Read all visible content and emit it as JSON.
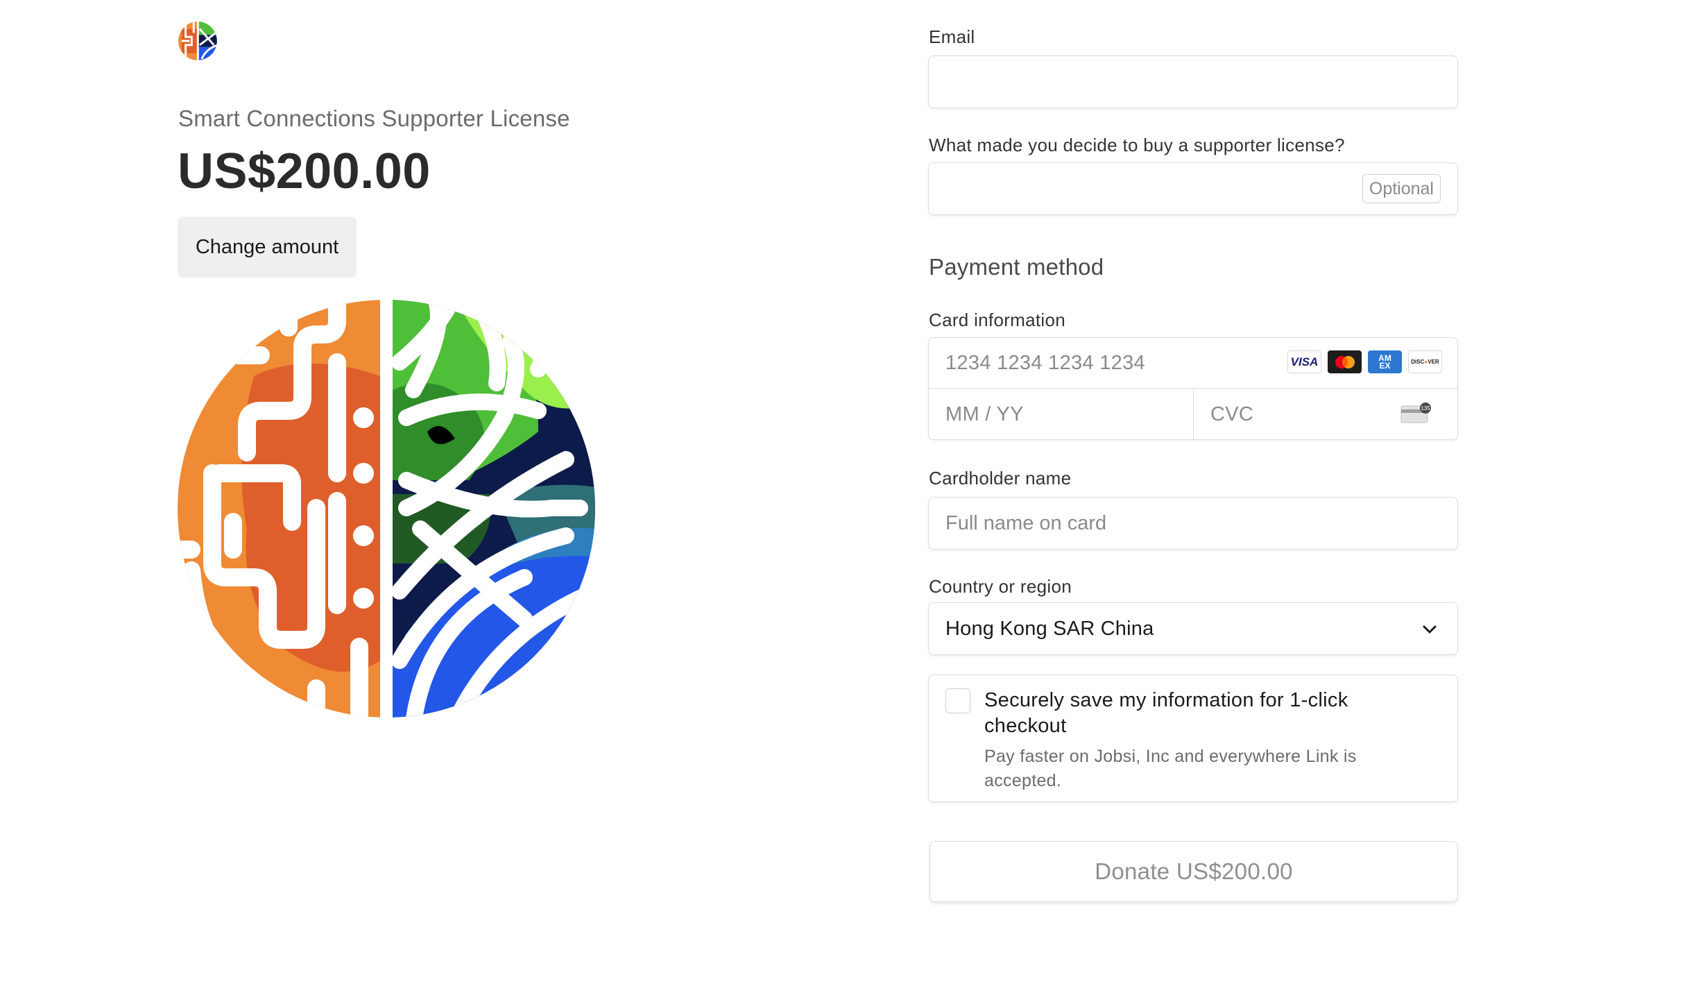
{
  "product": {
    "name": "Smart Connections Supporter License",
    "price": "US$200.00",
    "change_amount_label": "Change amount"
  },
  "form": {
    "email": {
      "label": "Email",
      "value": "",
      "placeholder": ""
    },
    "reason": {
      "label": "What made you decide to buy a supporter license?",
      "value": "",
      "optional_badge": "Optional"
    },
    "payment_section_title": "Payment method",
    "card": {
      "label": "Card information",
      "number_placeholder": "1234 1234 1234 1234",
      "expiry_placeholder": "MM / YY",
      "cvc_placeholder": "CVC",
      "brands": [
        "visa",
        "mastercard",
        "amex",
        "discover"
      ]
    },
    "cardholder": {
      "label": "Cardholder name",
      "placeholder": "Full name on card",
      "value": ""
    },
    "country": {
      "label": "Country or region",
      "selected": "Hong Kong SAR China"
    },
    "save_info": {
      "checked": false,
      "title": "Securely save my information for 1-click checkout",
      "description": "Pay faster on Jobsi, Inc and everywhere Link is accepted."
    },
    "submit_label": "Donate US$200.00"
  },
  "colors": {
    "orange": "#ef8a35",
    "orange_dark": "#de5f2b",
    "green": "#4fbf3a",
    "lime": "#9bef4c",
    "navy": "#0d1b4a",
    "blue": "#2357e8",
    "teal": "#2f6f76"
  },
  "icons": [
    "brain-logo-icon",
    "visa-icon",
    "mastercard-icon",
    "amex-icon",
    "discover-icon",
    "cvc-card-icon",
    "chevron-down-icon"
  ]
}
